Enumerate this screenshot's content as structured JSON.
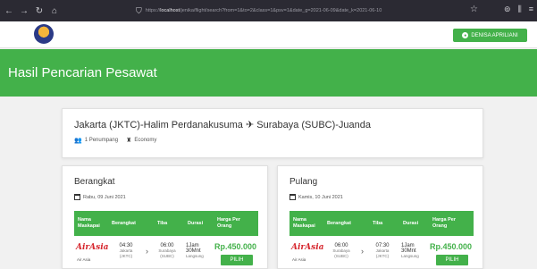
{
  "browser": {
    "back": "←",
    "forward": "→",
    "reload": "↻",
    "home": "⌂",
    "url_prefix": "https://",
    "url_host": "localhost",
    "url_path": "/jenika/flight/search?from=1&to=2&class=1&psv=1&date_g=2021-06-09&date_k=2021-06-10",
    "star": "☆",
    "icons": [
      "⊚",
      "⫼",
      "≡"
    ]
  },
  "header": {
    "user_button": "DENISA APRILIANI",
    "user_icon": "user-circle-icon"
  },
  "hero": {
    "title": "Hasil Pencarian Pesawat"
  },
  "route": {
    "from": "Jakarta (JKTC)-Halim Perdanakusuma",
    "plane_glyph": "✈",
    "to": "Surabaya (SUBC)-Juanda",
    "passengers": "1 Penumpang",
    "class": "Economy"
  },
  "table_headers": {
    "airline": "Nama Maskapai",
    "depart": "Berangkat",
    "arrive": "Tiba",
    "duration": "Durasi",
    "price": "Harga Per Orang"
  },
  "departure": {
    "heading": "Berangkat",
    "date": "Rabu, 09 Juni 2021",
    "row": {
      "airline_logo": "AirAsia",
      "airline_name": "Air Asia",
      "depart_time": "04:30",
      "depart_city": "Jakarta",
      "depart_code": "(JKTC)",
      "arrive_time": "06:00",
      "arrive_city": "Surabaya",
      "arrive_code": "(SUBC)",
      "dur1": "1Jam",
      "dur2": "30Mnt",
      "dur3": "Langsung",
      "price": "Rp.450.000",
      "button": "PILIH"
    }
  },
  "return": {
    "heading": "Pulang",
    "date": "Kamis, 10 Juni 2021",
    "row": {
      "airline_logo": "AirAsia",
      "airline_name": "Air Asia",
      "depart_time": "06:00",
      "depart_city": "Surabaya",
      "depart_code": "(SUBC)",
      "arrive_time": "07:30",
      "arrive_city": "Jakarta",
      "arrive_code": "(JKTC)",
      "dur1": "1Jam",
      "dur2": "30Mnt",
      "dur3": "Langsung",
      "price": "Rp.450.000",
      "button": "PILIH"
    }
  },
  "colors": {
    "brand_green": "#43b14a",
    "airline_red": "#d6262d",
    "browser_dark": "#2b2a33"
  }
}
